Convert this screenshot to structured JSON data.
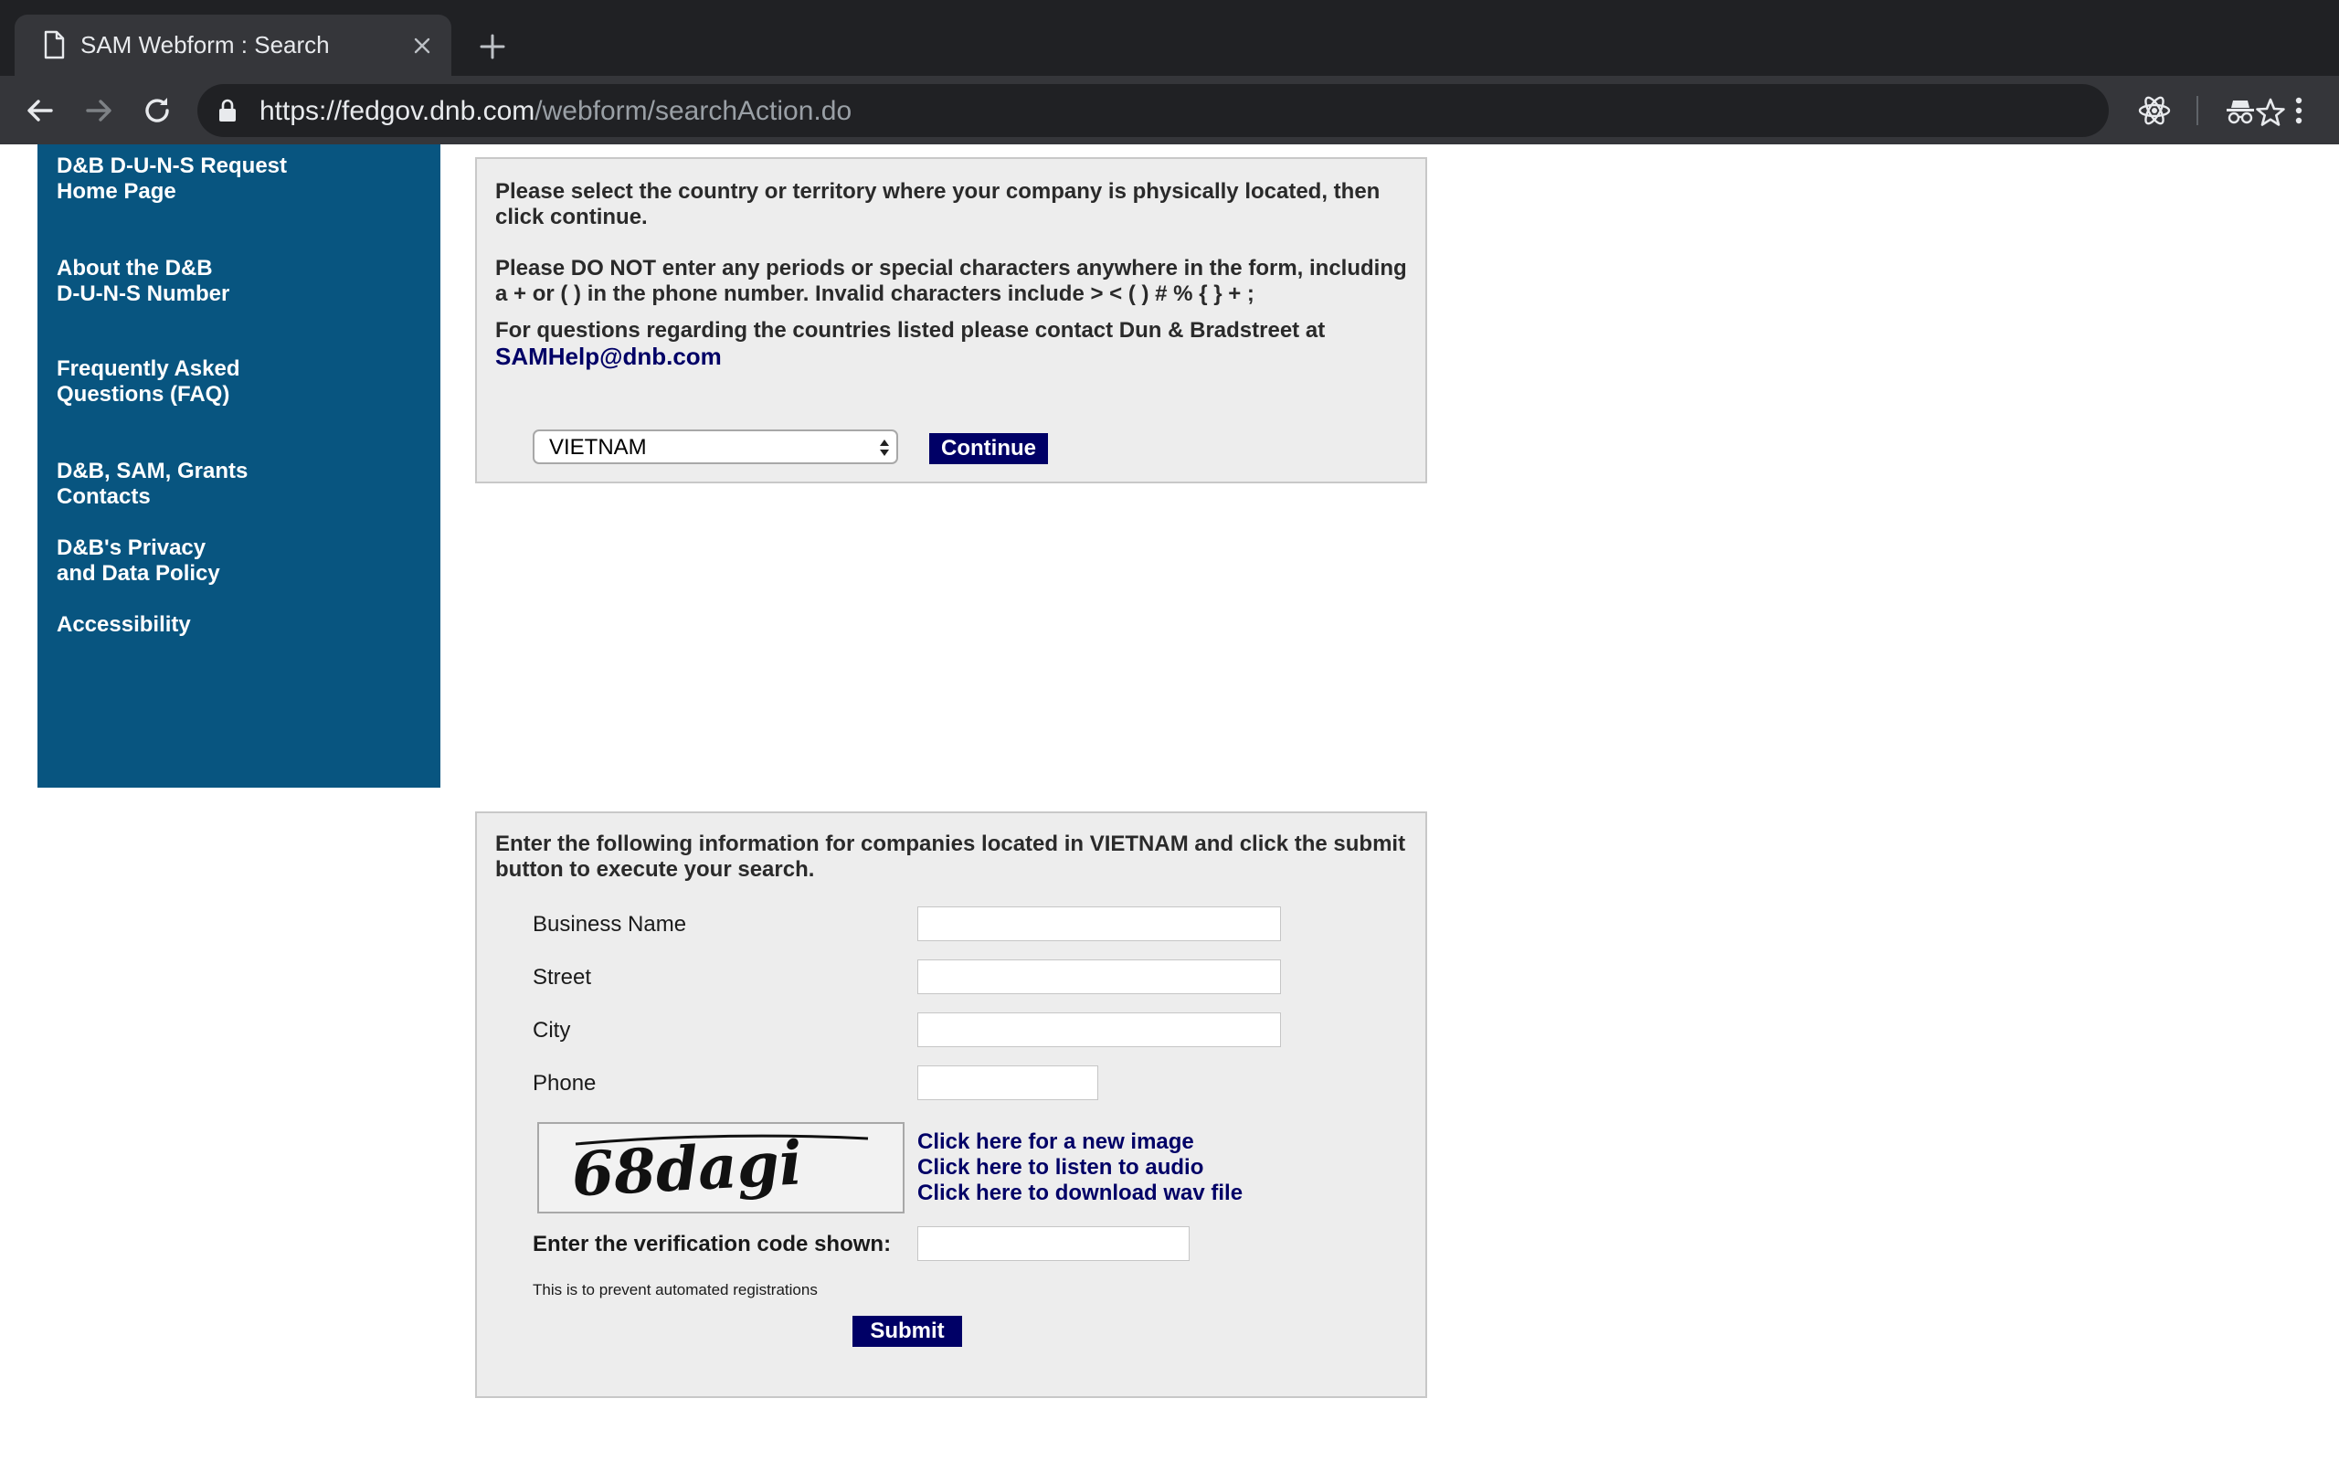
{
  "browser": {
    "tab_title": "SAM Webform : Search",
    "url_host": "https://fedgov.dnb.com",
    "url_path": "/webform/searchAction.do"
  },
  "sidebar": {
    "items": [
      {
        "line1": "D&B D-U-N-S Request",
        "line2": "Home Page"
      },
      {
        "line1": "About the D&B",
        "line2": "D-U-N-S Number"
      },
      {
        "line1": "Frequently Asked",
        "line2": "Questions (FAQ)"
      },
      {
        "line1": "D&B, SAM, Grants",
        "line2": "Contacts"
      },
      {
        "line1": "D&B's Privacy",
        "line2": "and Data Policy"
      },
      {
        "line1": "Accessibility",
        "line2": ""
      }
    ]
  },
  "country_panel": {
    "instruction1_l1": "Please select the country or territory where your company is physically located, then",
    "instruction1_l2": "click continue.",
    "instruction2_l1": "Please DO NOT enter any periods or special characters anywhere in the form, including",
    "instruction2_l2": "a + or ( ) in the phone number. Invalid characters include > < ( ) # % { } + ;",
    "instruction3": "For questions regarding the countries listed please contact Dun & Bradstreet at",
    "email": "SAMHelp@dnb.com",
    "country_value": "VIETNAM",
    "continue_label": "Continue"
  },
  "search_panel": {
    "intro_l1": "Enter the following information for companies located in VIETNAM and click the submit",
    "intro_l2": "button to execute your search.",
    "fields": {
      "business_name": "Business Name",
      "street": "Street",
      "city": "City",
      "phone": "Phone"
    },
    "captcha_text": "68dagi",
    "captcha_links": {
      "new_image": "Click here for a new image",
      "listen_audio": "Click here to listen to audio",
      "download_wav": "Click here to download wav file"
    },
    "verification_label": "Enter the verification code shown:",
    "note": "This is to prevent automated registrations",
    "submit_label": "Submit"
  },
  "colors": {
    "sidebar_bg": "#085580",
    "button_navy": "#000066",
    "panel_bg": "#ededed",
    "chrome_dark": "#202124",
    "chrome_toolbar": "#35363a"
  },
  "icons": {
    "tab": "document-icon",
    "close": "close-icon",
    "new_tab": "plus-icon",
    "back": "back-arrow-icon",
    "forward": "forward-arrow-icon",
    "reload": "reload-icon",
    "lock": "lock-icon",
    "bookmark": "star-icon",
    "extension": "react-atom-icon",
    "incognito": "incognito-icon",
    "menu": "kebab-menu-icon"
  }
}
